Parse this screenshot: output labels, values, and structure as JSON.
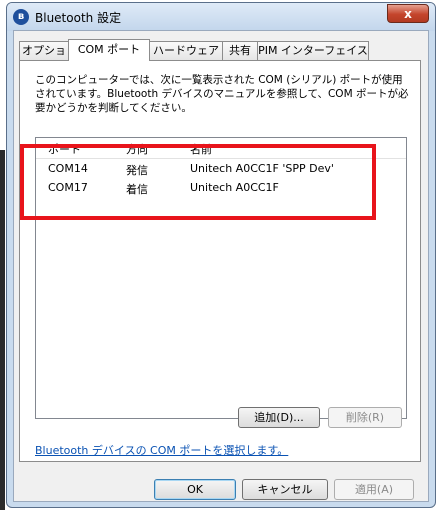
{
  "window": {
    "title": "Bluetooth 設定",
    "close_label": "x",
    "title_icon": "bluetooth-icon"
  },
  "tabs": [
    {
      "label": "オプション",
      "active": false
    },
    {
      "label": "COM ポート",
      "active": true
    },
    {
      "label": "ハードウェア",
      "active": false
    },
    {
      "label": "共有",
      "active": false
    },
    {
      "label": "PIM インターフェイス",
      "active": false
    }
  ],
  "description": "このコンピューターでは、次に一覧表示された COM (シリアル) ポートが使用されています。Bluetooth デバイスのマニュアルを参照して、COM ポートが必要かどうかを判断してください。",
  "list": {
    "headers": [
      "ポート",
      "方向",
      "名前"
    ],
    "rows": [
      [
        "COM14",
        "発信",
        "Unitech A0CC1F 'SPP Dev'"
      ],
      [
        "COM17",
        "着信",
        "Unitech A0CC1F"
      ]
    ]
  },
  "buttons": {
    "add": "追加(D)...",
    "remove": "削除(R)",
    "ok": "OK",
    "cancel": "キャンセル",
    "apply": "適用(A)"
  },
  "link": "Bluetooth デバイスの COM ポートを選択します。",
  "colors": {
    "highlight": "#e8141b",
    "link": "#0a52b3"
  }
}
